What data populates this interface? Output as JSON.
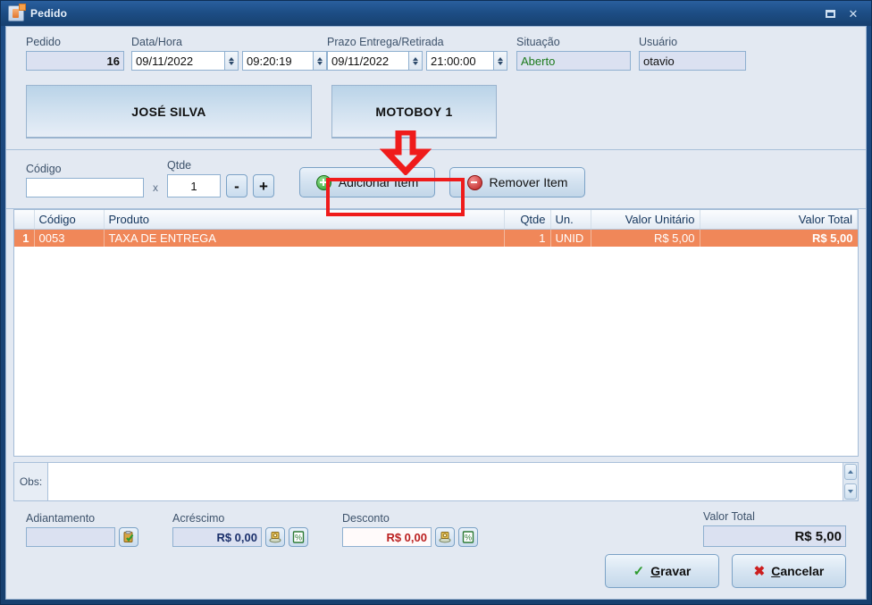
{
  "window": {
    "title": "Pedido",
    "icon": "order-icon",
    "maximize_label": "Maximizar",
    "close_label": "Fechar"
  },
  "header": {
    "pedido": {
      "label": "Pedido",
      "value": "16"
    },
    "data_hora": {
      "label": "Data/Hora",
      "date": "09/11/2022",
      "time": "09:20:19"
    },
    "prazo": {
      "label": "Prazo Entrega/Retirada",
      "date": "09/11/2022",
      "time": "21:00:00"
    },
    "situacao": {
      "label": "Situação",
      "value": "Aberto",
      "color": "#1c7a1c"
    },
    "usuario": {
      "label": "Usuário",
      "value": "otavio"
    }
  },
  "panels": {
    "cliente": "JOSÉ SILVA",
    "entregador": "MOTOBOY 1"
  },
  "entry": {
    "codigo": {
      "label": "Código",
      "value": "",
      "placeholder": ""
    },
    "multiplier": "x",
    "qtde": {
      "label": "Qtde",
      "value": "1"
    },
    "decrement_label": "-",
    "increment_label": "+",
    "add_item": {
      "label": "Adicionar Item",
      "icon": "plus-circle-icon"
    },
    "remove_item": {
      "label": "Remover Item",
      "icon": "minus-circle-icon"
    },
    "annotation": {
      "type": "red-down-arrow",
      "color": "#ef1b1b",
      "target": "Adicionar Item"
    }
  },
  "grid": {
    "columns": [
      "",
      "Código",
      "Produto",
      "Qtde",
      "Un.",
      "Valor Unitário",
      "Valor Total"
    ],
    "rows": [
      {
        "index": "1",
        "codigo": "0053",
        "produto": "TAXA DE ENTREGA",
        "qtde": "1",
        "un": "UNID",
        "valor_unitario": "R$ 5,00",
        "valor_total": "R$ 5,00",
        "selected": true
      }
    ],
    "selected_color": "#f08759"
  },
  "obs": {
    "label": "Obs:",
    "value": "",
    "placeholder": ""
  },
  "totals": {
    "adiantamento": {
      "label": "Adiantamento",
      "value": "",
      "button_icon": "clipboard-check-icon"
    },
    "acrescimo": {
      "label": "Acréscimo",
      "value": "R$ 0,00",
      "button1_icon": "money-icon",
      "button2_icon": "percent-icon"
    },
    "desconto": {
      "label": "Desconto",
      "value": "R$ 0,00",
      "button1_icon": "money-icon",
      "button2_icon": "percent-icon"
    },
    "valor_total": {
      "label": "Valor Total",
      "value": "R$ 5,00"
    }
  },
  "footer": {
    "gravar": {
      "accel": "G",
      "rest": "ravar",
      "icon": "check-icon"
    },
    "cancelar": {
      "accel": "C",
      "rest": "ancelar",
      "icon": "x-icon"
    }
  }
}
